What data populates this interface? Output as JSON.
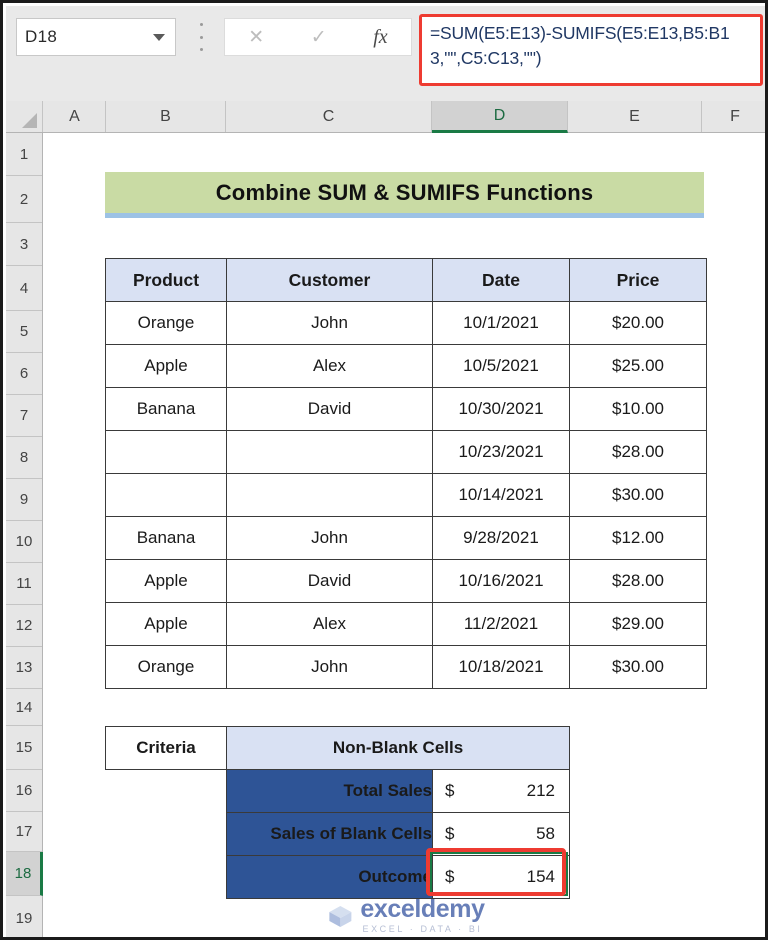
{
  "formula_bar": {
    "name_box_value": "D18",
    "cancel_icon": "close-icon",
    "enter_icon": "check-icon",
    "function_icon": "fx-icon",
    "formula": "=SUM(E5:E13)-SUMIFS(E5:E13,B5:B13,\"\",C5:C13,\"\")",
    "highlight_color": "#ee3b31"
  },
  "grid": {
    "columns": [
      "A",
      "B",
      "C",
      "D",
      "E",
      "F"
    ],
    "selected_column": "D",
    "rows": [
      "1",
      "2",
      "3",
      "4",
      "5",
      "6",
      "7",
      "8",
      "9",
      "10",
      "11",
      "12",
      "13",
      "14",
      "15",
      "16",
      "17",
      "18",
      "19"
    ],
    "selected_row": "18",
    "selection_color": "#1a7a45"
  },
  "title_banner": {
    "text": "Combine SUM & SUMIFS Functions",
    "background": "#c9dba4",
    "underline_color": "#9cc2e5"
  },
  "data_table": {
    "headers": [
      "Product",
      "Customer",
      "Date",
      "Price"
    ],
    "header_background": "#d9e1f3",
    "rows": [
      {
        "product": "Orange",
        "customer": "John",
        "date": "10/1/2021",
        "price": "$20.00"
      },
      {
        "product": "Apple",
        "customer": "Alex",
        "date": "10/5/2021",
        "price": "$25.00"
      },
      {
        "product": "Banana",
        "customer": "David",
        "date": "10/30/2021",
        "price": "$10.00"
      },
      {
        "product": "",
        "customer": "",
        "date": "10/23/2021",
        "price": "$28.00"
      },
      {
        "product": "",
        "customer": "",
        "date": "10/14/2021",
        "price": "$30.00"
      },
      {
        "product": "Banana",
        "customer": "John",
        "date": "9/28/2021",
        "price": "$12.00"
      },
      {
        "product": "Apple",
        "customer": "David",
        "date": "10/16/2021",
        "price": "$28.00"
      },
      {
        "product": "Apple",
        "customer": "Alex",
        "date": "11/2/2021",
        "price": "$29.00"
      },
      {
        "product": "Orange",
        "customer": "John",
        "date": "10/18/2021",
        "price": "$30.00"
      }
    ]
  },
  "results_table": {
    "criteria_label": "Criteria",
    "criteria_value": "Non-Blank Cells",
    "label_background": "#2e5496",
    "rows": [
      {
        "label": "Total Sales",
        "symbol": "$",
        "amount": "212"
      },
      {
        "label": "Sales of Blank Cells",
        "symbol": "$",
        "amount": "58"
      },
      {
        "label": "Outcome",
        "symbol": "$",
        "amount": "154"
      }
    ]
  },
  "watermark": {
    "name": "exceldemy",
    "tagline": "EXCEL · DATA · BI",
    "logo_icon": "cube-logo-icon",
    "color": "#2f4e9e"
  }
}
